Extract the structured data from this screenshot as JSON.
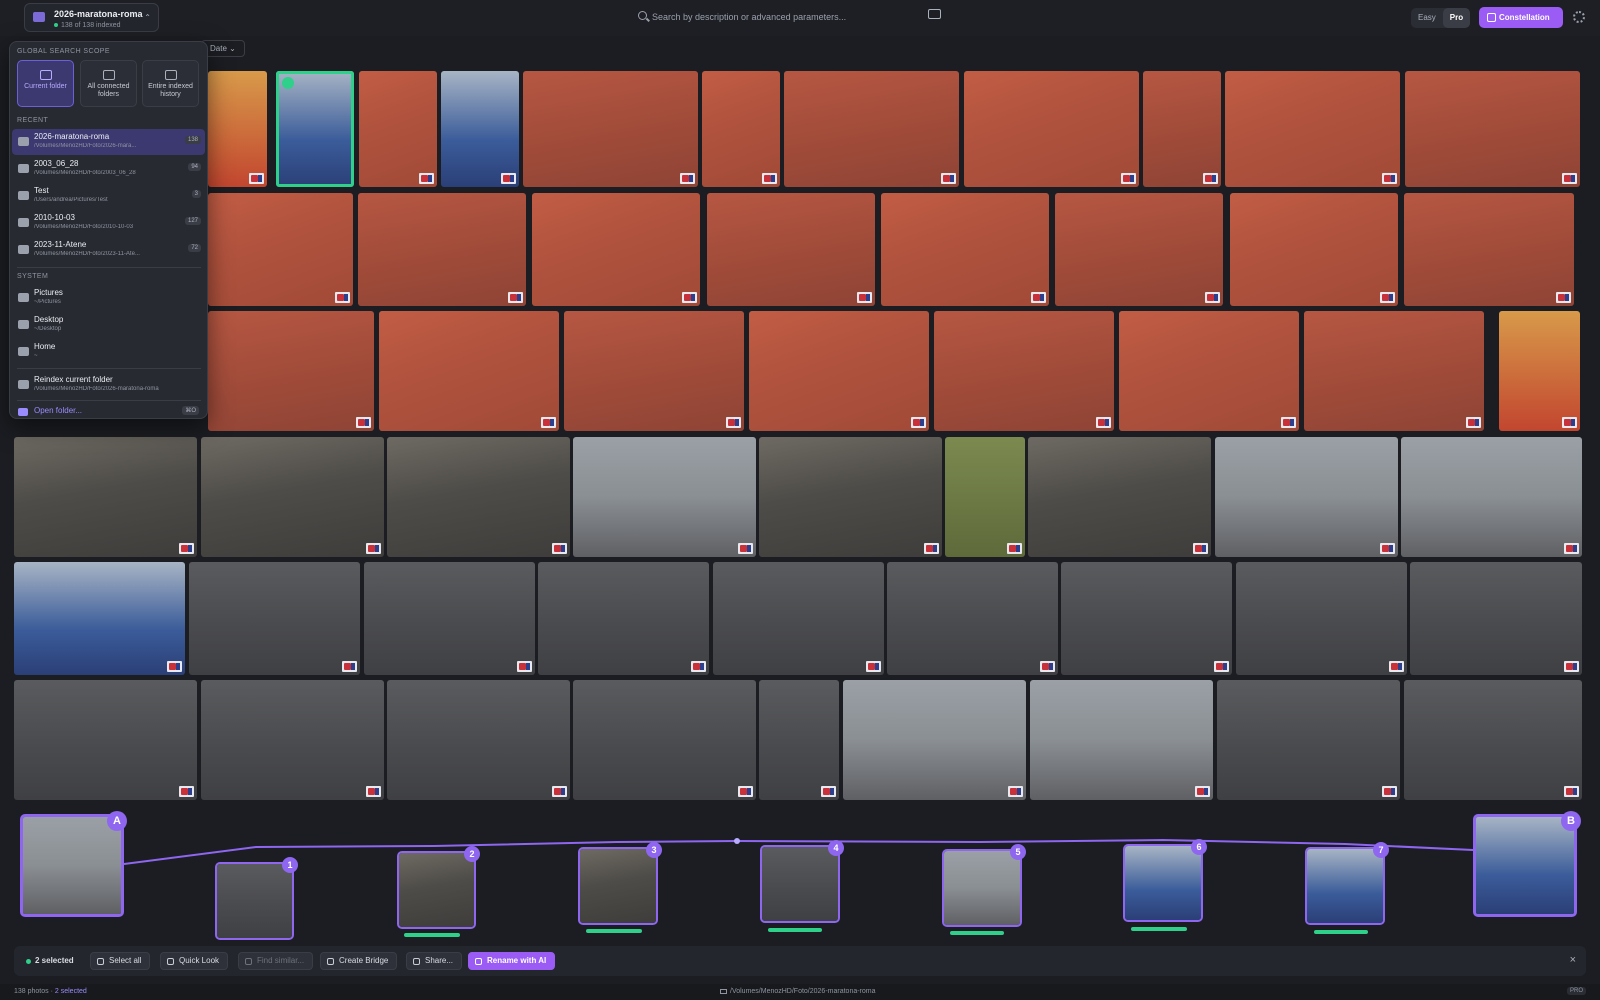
{
  "folder": {
    "name": "2026-maratona-roma",
    "indexed": "138 of 138 indexed"
  },
  "search": {
    "placeholder": "Search by description or advanced parameters..."
  },
  "modes": [
    "Easy",
    "Pro"
  ],
  "active_mode": "Pro",
  "constellation_label": "Constellation",
  "sort_label": "Date",
  "dropdown": {
    "scope_title": "GLOBAL SEARCH SCOPE",
    "scopes": [
      {
        "label": "Current folder",
        "active": true
      },
      {
        "label": "All connected folders",
        "active": false
      },
      {
        "label": "Entire indexed history",
        "active": false
      }
    ],
    "recent_title": "RECENT",
    "recent": [
      {
        "name": "2026-maratona-roma",
        "path": "/Volumes/MenozHD/Foto/2026-mara...",
        "count": "138"
      },
      {
        "name": "2003_06_28",
        "path": "/Volumes/MenozHD/Foto/2003_06_28",
        "count": "94"
      },
      {
        "name": "Test",
        "path": "/Users/andrea/Pictures/Test",
        "count": "3"
      },
      {
        "name": "2010-10-03",
        "path": "/Volumes/MenozHD/Foto/2010-10-03",
        "count": "127"
      },
      {
        "name": "2023-11-Atene",
        "path": "/Volumes/MenozHD/Foto/2023-11-Ate...",
        "count": "72"
      }
    ],
    "system_title": "SYSTEM",
    "system": [
      {
        "name": "Pictures",
        "path": "~/Pictures"
      },
      {
        "name": "Desktop",
        "path": "~/Desktop"
      },
      {
        "name": "Home",
        "path": "~"
      }
    ],
    "reindex": {
      "name": "Reindex current folder",
      "path": "/Volumes/MenozHD/Foto/2026-maratona-roma"
    },
    "open_folder": "Open folder...",
    "open_shortcut": "⌘O"
  },
  "bridge": {
    "start_label": "A",
    "end_label": "B",
    "steps": [
      "1",
      "2",
      "3",
      "4",
      "5",
      "6",
      "7"
    ]
  },
  "actions": {
    "selected": "2 selected",
    "select_all": "Select all",
    "quick_look": "Quick Look",
    "find_similar": "Find similar...",
    "create_bridge": "Create Bridge",
    "share": "Share...",
    "rename_ai": "Rename with AI",
    "close": "×"
  },
  "status": {
    "photos": "138 photos",
    "separator": " · ",
    "selected": "2 selected",
    "path": "/Volumes/MenozHD/Foto/2026-maratona-roma",
    "badge": "PRO"
  },
  "colors": {
    "accent": "#9b5cf6",
    "selection": "#2fd08a",
    "background": "#1b1d22"
  }
}
